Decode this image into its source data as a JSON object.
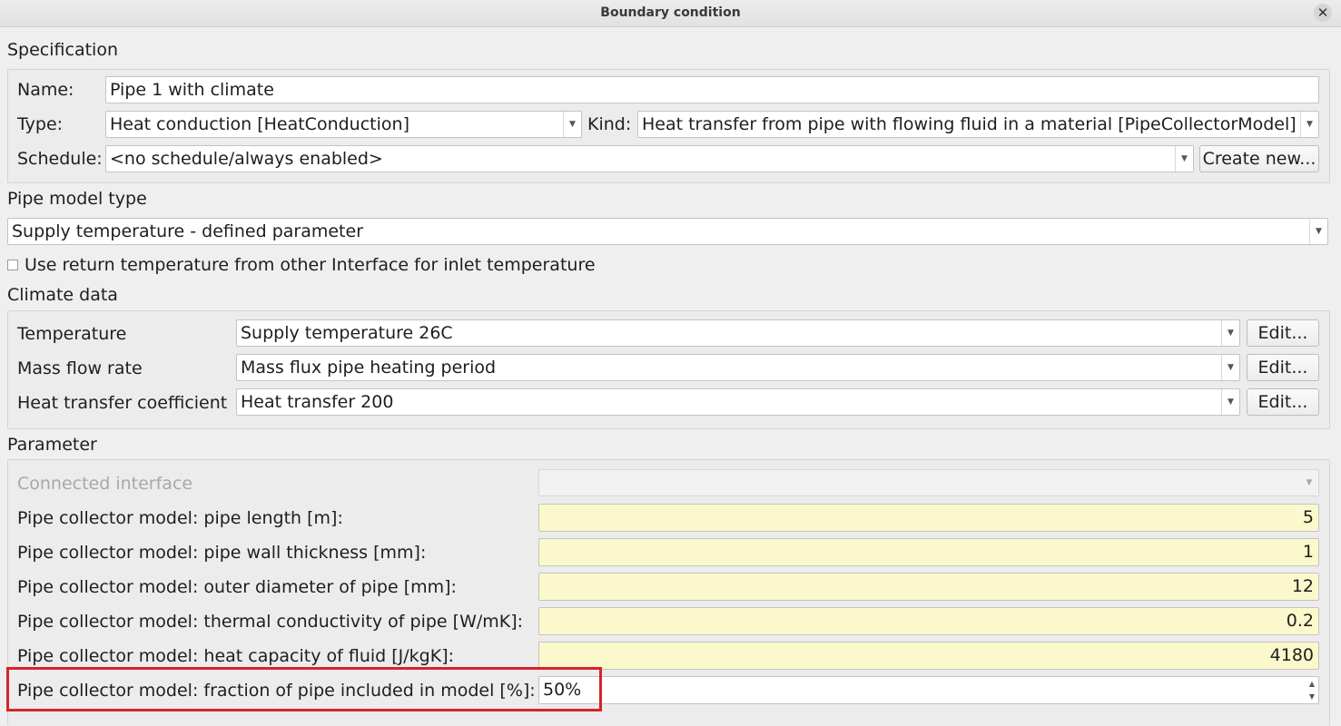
{
  "window": {
    "title": "Boundary condition"
  },
  "specification": {
    "title": "Specification",
    "name_label": "Name:",
    "name_value": "Pipe 1 with climate",
    "type_label": "Type:",
    "type_value": "Heat conduction [HeatConduction]",
    "kind_label": "Kind:",
    "kind_value": "Heat transfer from pipe with flowing fluid in a material [PipeCollectorModel]",
    "schedule_label": "Schedule:",
    "schedule_value": "<no schedule/always enabled>",
    "create_new_label": "Create new..."
  },
  "pipe_model": {
    "title": "Pipe model type",
    "value": "Supply temperature - defined parameter",
    "checkbox_label": "Use return temperature from other Interface for inlet temperature",
    "checkbox_checked": false
  },
  "climate": {
    "title": "Climate data",
    "edit_label": "Edit...",
    "rows": [
      {
        "label": "Temperature",
        "value": "Supply temperature 26C"
      },
      {
        "label": "Mass flow rate",
        "value": "Mass flux pipe heating period"
      },
      {
        "label": "Heat transfer coefficient",
        "value": "Heat transfer 200"
      }
    ]
  },
  "parameter": {
    "title": "Parameter",
    "connected_interface_label": "Connected interface",
    "connected_interface_value": "",
    "rows": [
      {
        "label": "Pipe collector model: pipe length [m]:",
        "value": "5"
      },
      {
        "label": "Pipe collector model: pipe wall thickness [mm]:",
        "value": "1"
      },
      {
        "label": "Pipe collector model: outer diameter of pipe [mm]:",
        "value": "12"
      },
      {
        "label": "Pipe collector model: thermal conductivity of pipe [W/mK]:",
        "value": "0.2"
      },
      {
        "label": "Pipe collector model: heat capacity of fluid [J/kgK]:",
        "value": "4180"
      }
    ],
    "fraction_label": "Pipe collector model: fraction of pipe included in model [%]:",
    "fraction_value": "50%"
  },
  "colors": {
    "highlight": "#d8222a",
    "parameter_field": "#fbf8cc"
  }
}
